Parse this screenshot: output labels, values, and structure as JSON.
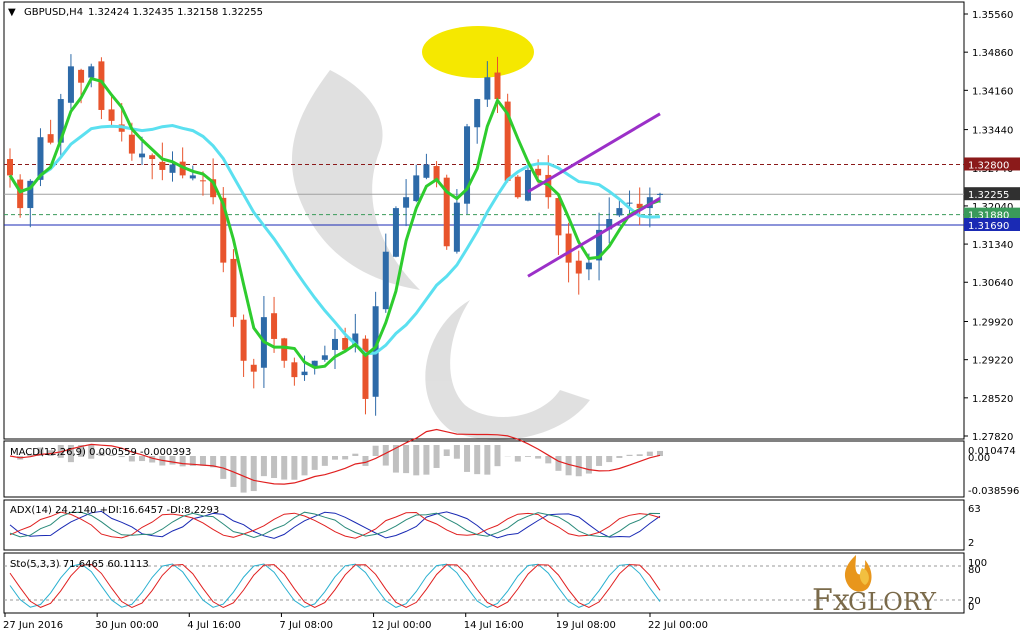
{
  "header": {
    "symbol": "GBPUSD,H4",
    "ohlc": "1.32424 1.32435 1.32158 1.32255"
  },
  "price_axis": {
    "ticks": [
      "1.35560",
      "1.34860",
      "1.34160",
      "1.33440",
      "1.32740",
      "1.32040",
      "1.31340",
      "1.30640",
      "1.29920",
      "1.29220",
      "1.28520",
      "1.27820"
    ],
    "range": [
      1.2782,
      1.3556
    ]
  },
  "price_tags": [
    {
      "label": "1.32800",
      "value": 1.328,
      "color": "#8b1a1a"
    },
    {
      "label": "1.32255",
      "value": 1.32255,
      "color": "#303030"
    },
    {
      "label": "1.31880",
      "value": 1.3188,
      "color": "#3a9a5a"
    },
    {
      "label": "1.31690",
      "value": 1.3169,
      "color": "#1a2ab4"
    }
  ],
  "time_axis": {
    "labels": [
      "27 Jun 2016",
      "30 Jun 00:00",
      "4 Jul 16:00",
      "7 Jul 08:00",
      "12 Jul 00:00",
      "14 Jul 16:00",
      "19 Jul 08:00",
      "22 Jul 00:00"
    ]
  },
  "indicators": {
    "macd": {
      "label": "MACD(12,26,9) 0.000559 -0.000393",
      "ticks": [
        "0.010474",
        "0.00",
        "-0.038596"
      ]
    },
    "adx": {
      "label": "ADX(14) 24.2140 +DI:16.6457 -DI:8.2293",
      "ticks": [
        "63",
        "2"
      ]
    },
    "stoch": {
      "label": "Sto(5,3,3) 71.6465 60.1113",
      "ticks": [
        "100",
        "80",
        "20",
        "0"
      ]
    }
  },
  "logo": {
    "text_fx": "Fx",
    "text_glory": "GLORY"
  },
  "colors": {
    "bull": "#2d6aa8",
    "bear": "#e8542c",
    "fast_ma": "#2ecc2e",
    "slow_ma": "#5be0f0",
    "channel": "#9b30c8",
    "highlight": "#f5e800"
  },
  "chart_data": {
    "type": "candlestick",
    "title": "GBPUSD,H4",
    "ylim": [
      1.2782,
      1.3556
    ],
    "close_series_approx": [
      1.326,
      1.32,
      1.325,
      1.333,
      1.332,
      1.34,
      1.346,
      1.343,
      1.346,
      1.338,
      1.336,
      1.334,
      1.33,
      1.33,
      1.329,
      1.327,
      1.328,
      1.326,
      1.326,
      1.325,
      1.322,
      1.31,
      1.3,
      1.292,
      1.29,
      1.3,
      1.296,
      1.292,
      1.289,
      1.29,
      1.292,
      1.293,
      1.296,
      1.294,
      1.297,
      1.285,
      1.302,
      1.312,
      1.32,
      1.322,
      1.326,
      1.328,
      1.325,
      1.313,
      1.321,
      1.335,
      1.34,
      1.344,
      1.34,
      1.325,
      1.322,
      1.327,
      1.326,
      1.322,
      1.315,
      1.31,
      1.308,
      1.31,
      1.316,
      1.318,
      1.32,
      1.321,
      1.32,
      1.322,
      1.3226
    ],
    "moving_averages": [
      {
        "name": "fast",
        "color": "#2ecc2e"
      },
      {
        "name": "slow",
        "color": "#5be0f0"
      }
    ],
    "horizontal_levels": [
      1.328,
      1.32255,
      1.3188,
      1.3169
    ]
  }
}
